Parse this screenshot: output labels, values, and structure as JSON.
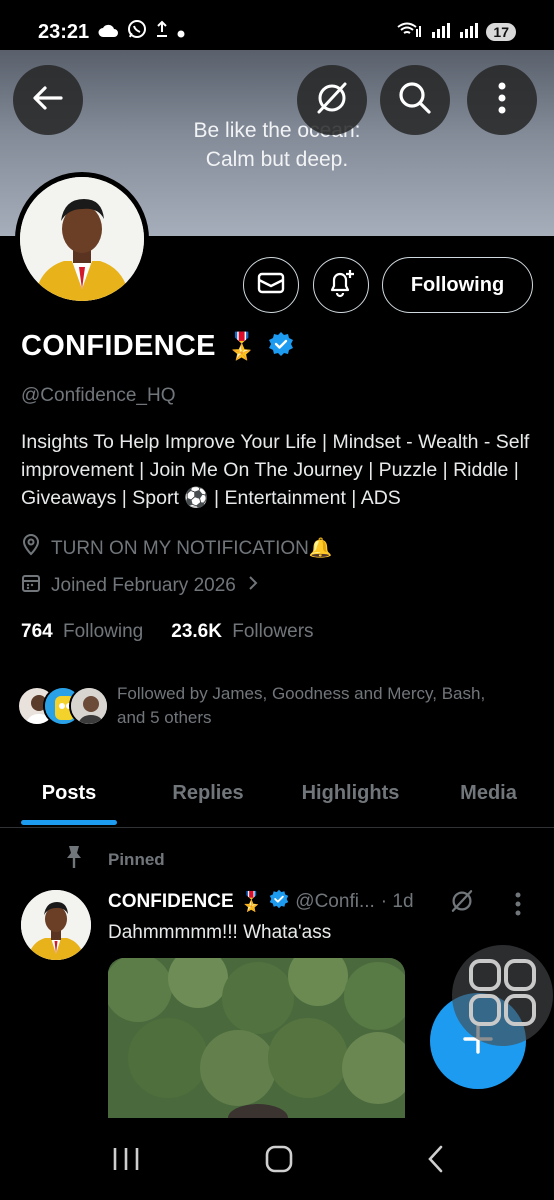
{
  "status_bar": {
    "time": "23:21",
    "left_icons": [
      "cloud-icon",
      "whatsapp-icon",
      "upload-icon",
      "dot-icon"
    ],
    "right_icons": [
      "wifi-calling-icon",
      "signal-icon",
      "signal-icon"
    ],
    "battery": "17"
  },
  "header": {
    "banner_text_line1": "Be like the ocean:",
    "banner_text_line2": "Calm but deep.",
    "back_icon": "back-arrow-icon",
    "grok_icon": "grok-icon",
    "search_icon": "search-icon",
    "more_icon": "more-vertical-icon"
  },
  "profile": {
    "display_name": "CONFIDENCE",
    "name_emoji": "🎖️",
    "verified": true,
    "handle": "@Confidence_HQ",
    "bio": "Insights To Help Improve Your Life | Mindset - Wealth - Self improvement | Join Me On The Journey | Puzzle | Riddle | Giveaways | Sport ⚽ | Entertainment | ADS",
    "location": "TURN ON MY NOTIFICATION🔔",
    "joined": "Joined February 2026",
    "following_count": "764",
    "following_label": "Following",
    "followers_count": "23.6K",
    "followers_label": "Followers",
    "followed_by_line1": "Followed by James, Goodness and Mercy, Bash,",
    "followed_by_line2": "and 5 others"
  },
  "actions": {
    "message_icon": "mail-icon",
    "notify_icon": "bell-plus-icon",
    "follow_button": "Following"
  },
  "tabs": [
    {
      "label": "Posts",
      "active": true
    },
    {
      "label": "Replies",
      "active": false
    },
    {
      "label": "Highlights",
      "active": false
    },
    {
      "label": "Media",
      "active": false
    }
  ],
  "pinned_post": {
    "pinned_label": "Pinned",
    "author": "CONFIDENCE",
    "author_emoji": "🎖️",
    "handle": "@Confi...",
    "time": "· 1d",
    "text": "Dahmmmmm!!! Whata'ass"
  },
  "colors": {
    "accent": "#1d9bf0",
    "background": "#000000",
    "secondary_text": "#71767b",
    "primary_text": "#e7e9ea",
    "verified_badge": "#1d9bf0"
  },
  "fab_icon": "plus-icon",
  "nav_icons": [
    "recent-apps-icon",
    "home-icon",
    "back-icon"
  ]
}
